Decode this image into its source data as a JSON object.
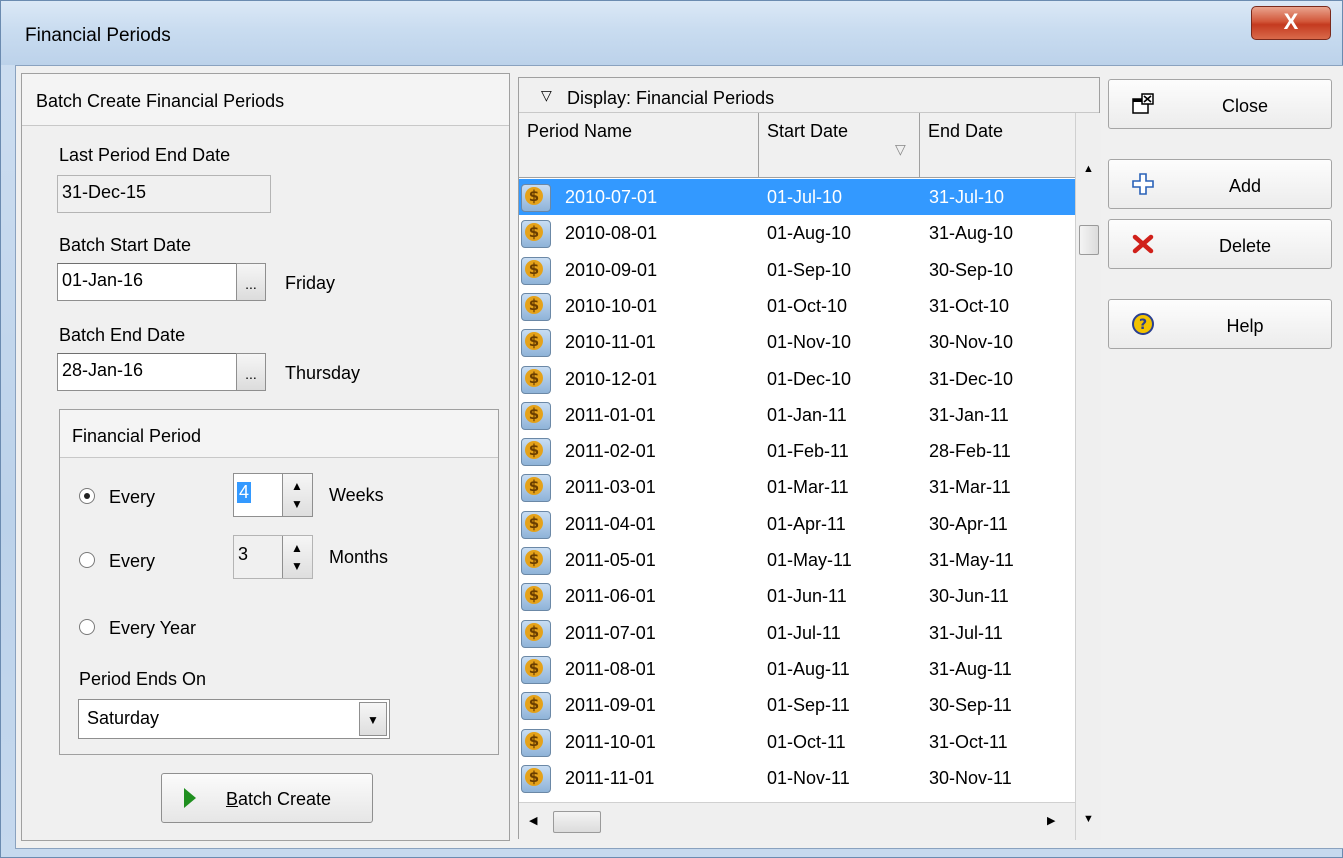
{
  "window": {
    "title": "Financial Periods",
    "close_glyph": "X"
  },
  "left": {
    "header": "Batch Create Financial Periods",
    "last_period_label": "Last Period End Date",
    "last_period_value": "31-Dec-15",
    "batch_start_label": "Batch Start Date",
    "batch_start_value": "01-Jan-16",
    "batch_start_day": "Friday",
    "batch_end_label": "Batch End Date",
    "batch_end_value": "28-Jan-16",
    "batch_end_day": "Thursday",
    "dots": "...",
    "group": {
      "header": "Financial Period",
      "opt_weeks_label": "Every",
      "weeks_value": "4",
      "weeks_unit": "Weeks",
      "opt_months_label": "Every",
      "months_value": "3",
      "months_unit": "Months",
      "opt_year_label": "Every Year",
      "selected_option": "weeks",
      "period_ends_label": "Period Ends On",
      "period_ends_value": "Saturday"
    },
    "batch_create_prefix": "B",
    "batch_create_rest": "atch Create"
  },
  "grid": {
    "caption": "Display: Financial Periods",
    "columns": [
      "Period Name",
      "Start Date",
      "End Date"
    ],
    "selected_row": 0,
    "rows": [
      [
        "2010-07-01",
        "01-Jul-10",
        "31-Jul-10"
      ],
      [
        "2010-08-01",
        "01-Aug-10",
        "31-Aug-10"
      ],
      [
        "2010-09-01",
        "01-Sep-10",
        "30-Sep-10"
      ],
      [
        "2010-10-01",
        "01-Oct-10",
        "31-Oct-10"
      ],
      [
        "2010-11-01",
        "01-Nov-10",
        "30-Nov-10"
      ],
      [
        "2010-12-01",
        "01-Dec-10",
        "31-Dec-10"
      ],
      [
        "2011-01-01",
        "01-Jan-11",
        "31-Jan-11"
      ],
      [
        "2011-02-01",
        "01-Feb-11",
        "28-Feb-11"
      ],
      [
        "2011-03-01",
        "01-Mar-11",
        "31-Mar-11"
      ],
      [
        "2011-04-01",
        "01-Apr-11",
        "30-Apr-11"
      ],
      [
        "2011-05-01",
        "01-May-11",
        "31-May-11"
      ],
      [
        "2011-06-01",
        "01-Jun-11",
        "30-Jun-11"
      ],
      [
        "2011-07-01",
        "01-Jul-11",
        "31-Jul-11"
      ],
      [
        "2011-08-01",
        "01-Aug-11",
        "31-Aug-11"
      ],
      [
        "2011-09-01",
        "01-Sep-11",
        "30-Sep-11"
      ],
      [
        "2011-10-01",
        "01-Oct-11",
        "31-Oct-11"
      ],
      [
        "2011-11-01",
        "01-Nov-11",
        "30-Nov-11"
      ]
    ]
  },
  "actions": {
    "close": "Close",
    "add": "Add",
    "delete": "Delete",
    "help": "Help"
  },
  "colors": {
    "selection": "#3399ff",
    "delete_icon": "#d0201a",
    "add_icon": "#2a62b8",
    "help_icon": "#f2c200"
  }
}
